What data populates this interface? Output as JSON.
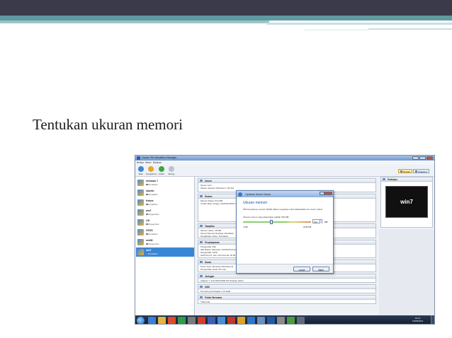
{
  "slide": {
    "title": "Tentukan ukuran memori"
  },
  "window": {
    "title": "Oracle VM VirtualBox Manager",
    "menu": [
      "Berkas",
      "Mesin",
      "Bantuan"
    ],
    "toolbar": [
      "Baru",
      "Pengaturan",
      "Mulai",
      "Buang"
    ],
    "right_tabs": [
      "Rincian",
      "Snapshot"
    ]
  },
  "vms": [
    {
      "name": "windows 7",
      "state": "Dimatikan",
      "selected": false
    },
    {
      "name": "ubuntu",
      "state": "Dimatikan",
      "selected": false
    },
    {
      "name": "fedora",
      "state": "Dimatikan",
      "selected": false
    },
    {
      "name": "win7",
      "state": "Digugurkan",
      "selected": false
    },
    {
      "name": "LM",
      "state": "Digugurkan",
      "selected": false
    },
    {
      "name": "CEOS",
      "state": "Dimatikan",
      "selected": false
    },
    {
      "name": "win08",
      "state": "Digugurkan",
      "selected": false
    },
    {
      "name": "win7",
      "state": "Dimatikan",
      "selected": true
    }
  ],
  "sections": {
    "umum": {
      "title": "Umum",
      "lines": [
        "Nama:         win7",
        "Sistem Operasi:   Windows 7 (32 bit)"
      ]
    },
    "sistem": {
      "title": "Sistem",
      "lines": [
        "Memori Dasar:   512 MB",
        "Urutan Boot:    Floppy, CD/DVD-ROM, Hard Disk"
      ]
    },
    "tampilan": {
      "title": "Tampilan",
      "lines": [
        "Memori Video:       18 MB",
        "Server Remote Desktop:  Dimatikan",
        "Penglihatan Video:    Dimatikan"
      ]
    },
    "penyimpanan": {
      "title": "Penyimpanan",
      "lines": [
        "Pengendali: IDE",
        "  IDE Master Sekunder: [CD/DVD] Kosong",
        "Pengendali: SATA",
        "  SATA Port 0:       win7.vdi (Normal, 25.00 GB)"
      ]
    },
    "suara": {
      "title": "Suara",
      "lines": [
        "Driver Host:   Windows DirectSound",
        "Pengendali:    Audio HD Intel"
      ]
    },
    "jaringan": {
      "title": "Jaringan",
      "lines": [
        "Adapter 1:   Intel PRO/1000 MT Desktop (NAT)"
      ]
    },
    "usb": {
      "title": "USB",
      "lines": [
        "Penyaring Perangkat:   0 (0 aktif)"
      ]
    },
    "folder": {
      "title": "Folder Bersama",
      "lines": [
        "Tidak Ada"
      ]
    }
  },
  "preview": {
    "title": "Pratinjau",
    "screen_text": "win7"
  },
  "dialog": {
    "title": "Ciptakan Mesin Virtual",
    "heading": "Ukuran memori",
    "description": "Pilih banyaknya memori (RAM) dalam megabyte untuk dialokasikan ke mesin virtual.",
    "recommend": "Ukuran memori yang disarankan adalah 256 MB.",
    "value": "512",
    "unit": "MB",
    "min_label": "4 MB",
    "max_label": "2048 MB",
    "next": "Lanjut",
    "cancel": "Batal"
  },
  "taskbar": {
    "time": "16:12",
    "date": "13/05/2013"
  }
}
